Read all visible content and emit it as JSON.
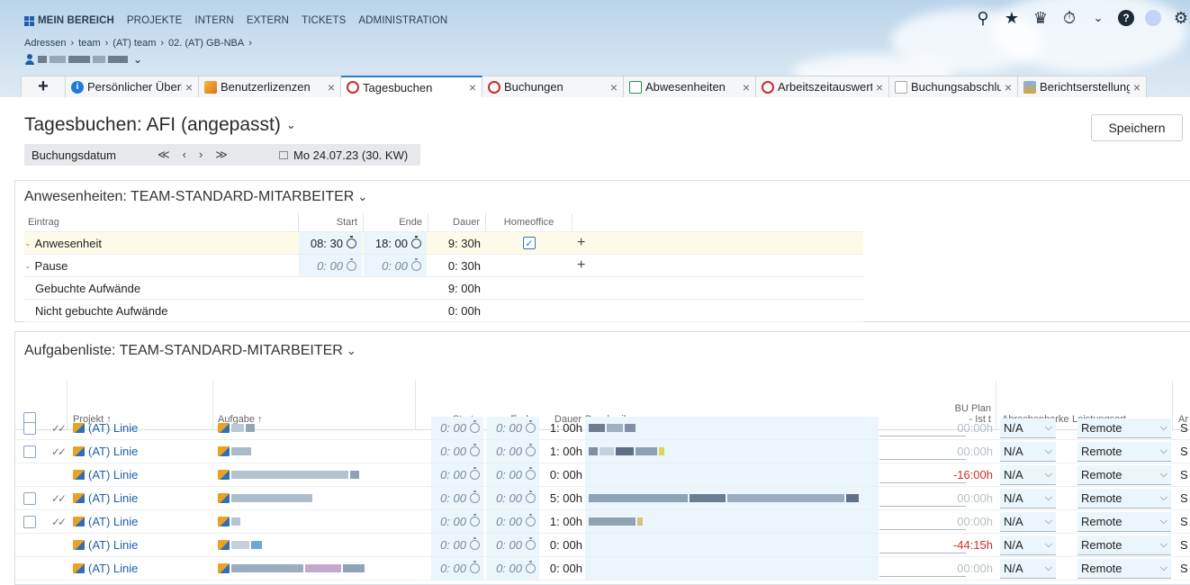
{
  "topnav": {
    "items": [
      "MEIN BEREICH",
      "PROJEKTE",
      "INTERN",
      "EXTERN",
      "TICKETS",
      "ADMINISTRATION"
    ],
    "active_index": 0
  },
  "breadcrumb": [
    "Adressen",
    "team",
    "(AT) team",
    "02. (AT) GB-NBA"
  ],
  "breadcrumb_sep": "›",
  "toolbar_icons": [
    "search-icon",
    "star-icon",
    "bell-icon",
    "stopwatch-icon",
    "chevron-down-icon",
    "help-icon",
    "user-avatar",
    "gear-icon"
  ],
  "tabs": {
    "add_label": "+",
    "items": [
      {
        "label": "Persönlicher Überblick",
        "icon": "info-icon",
        "active": false
      },
      {
        "label": "Benutzerlizenzen",
        "icon": "key-icon",
        "active": false
      },
      {
        "label": "Tagesbuchen",
        "icon": "stopwatch-icon",
        "active": true
      },
      {
        "label": "Buchungen",
        "icon": "stopwatch-icon",
        "active": false
      },
      {
        "label": "Abwesenheiten",
        "icon": "calendar-icon",
        "active": false
      },
      {
        "label": "Arbeitszeitauswertung",
        "icon": "stopwatch-icon",
        "active": false
      },
      {
        "label": "Buchungsabschluss",
        "icon": "chart-icon",
        "active": false
      },
      {
        "label": "Berichtserstellung",
        "icon": "report-icon",
        "active": false
      }
    ],
    "close_glyph": "×"
  },
  "page": {
    "title": "Tagesbuchen: AFI (angepasst)",
    "save_label": "Speichern"
  },
  "date_bar": {
    "label": "Buchungsdatum",
    "nav": [
      "≪",
      "‹",
      "›",
      "≫"
    ],
    "date": "Mo 24.07.23 (30. KW)"
  },
  "attendance": {
    "title": "Anwesenheiten: TEAM-STANDARD-MITARBEITER",
    "headers": {
      "entry": "Eintrag",
      "start": "Start",
      "end": "Ende",
      "duration": "Dauer",
      "homeoffice": "Homeoffice"
    },
    "rows": [
      {
        "entry": "Anwesenheit",
        "start": "08: 30",
        "end": "18: 00",
        "duration": "9: 30h",
        "homeoffice": true,
        "editable": true
      },
      {
        "entry": "Pause",
        "start": "0: 00",
        "end": "0: 00",
        "duration": "0: 30h",
        "homeoffice": false,
        "editable": true
      },
      {
        "entry": "Gebuchte Aufwände",
        "start": "",
        "end": "",
        "duration": "9: 00h",
        "homeoffice": false,
        "editable": false
      },
      {
        "entry": "Nicht gebuchte Aufwände",
        "start": "",
        "end": "",
        "duration": "0: 00h",
        "homeoffice": false,
        "editable": false
      }
    ],
    "plus": "+"
  },
  "tasks": {
    "title": "Aufgabenliste: TEAM-STANDARD-MITARBEITER",
    "headers": {
      "project": "Projekt ↑",
      "task": "Aufgabe ↑",
      "start": "Start",
      "end": "Ende",
      "duration": "Dauer",
      "description": "Beschreibung",
      "bu_plan_1": "BU Plan",
      "bu_plan_2": "- Ist t",
      "billable": "Abrechenbarke",
      "location": "Leistungsort",
      "extra": "Ar"
    },
    "rows": [
      {
        "checkbox": true,
        "booked": true,
        "project": "(AT) Linie",
        "start": "0: 00",
        "end": "0: 00",
        "duration": "1: 00h",
        "bu": "00:00h",
        "bu_negative": false,
        "billable": "N/A",
        "location": "Remote",
        "extra": "S"
      },
      {
        "checkbox": true,
        "booked": true,
        "project": "(AT) Linie",
        "start": "0: 00",
        "end": "0: 00",
        "duration": "1: 00h",
        "bu": "00:00h",
        "bu_negative": false,
        "billable": "N/A",
        "location": "Remote",
        "extra": "S"
      },
      {
        "checkbox": false,
        "booked": false,
        "project": "(AT) Linie",
        "start": "0: 00",
        "end": "0: 00",
        "duration": "0: 00h",
        "bu": "-16:00h",
        "bu_negative": true,
        "billable": "N/A",
        "location": "Remote",
        "extra": "S"
      },
      {
        "checkbox": true,
        "booked": true,
        "project": "(AT) Linie",
        "start": "0: 00",
        "end": "0: 00",
        "duration": "5: 00h",
        "bu": "00:00h",
        "bu_negative": false,
        "billable": "N/A",
        "location": "Remote",
        "extra": "S"
      },
      {
        "checkbox": true,
        "booked": true,
        "project": "(AT) Linie",
        "start": "0: 00",
        "end": "0: 00",
        "duration": "1: 00h",
        "bu": "00:00h",
        "bu_negative": false,
        "billable": "N/A",
        "location": "Remote",
        "extra": "S"
      },
      {
        "checkbox": false,
        "booked": false,
        "project": "(AT) Linie",
        "start": "0: 00",
        "end": "0: 00",
        "duration": "0: 00h",
        "bu": "-44:15h",
        "bu_negative": true,
        "billable": "N/A",
        "location": "Remote",
        "extra": "S"
      },
      {
        "checkbox": false,
        "booked": false,
        "project": "(AT) Linie",
        "start": "0: 00",
        "end": "0: 00",
        "duration": "0: 00h",
        "bu": "00:00h",
        "bu_negative": false,
        "billable": "N/A",
        "location": "Remote",
        "extra": "S"
      }
    ]
  },
  "colors": {
    "accent": "#2b78c9",
    "link": "#1f5fa8",
    "negative": "#d62b2b",
    "input_bg": "#eaf5fc",
    "highlight_row": "#fdfbe8"
  }
}
